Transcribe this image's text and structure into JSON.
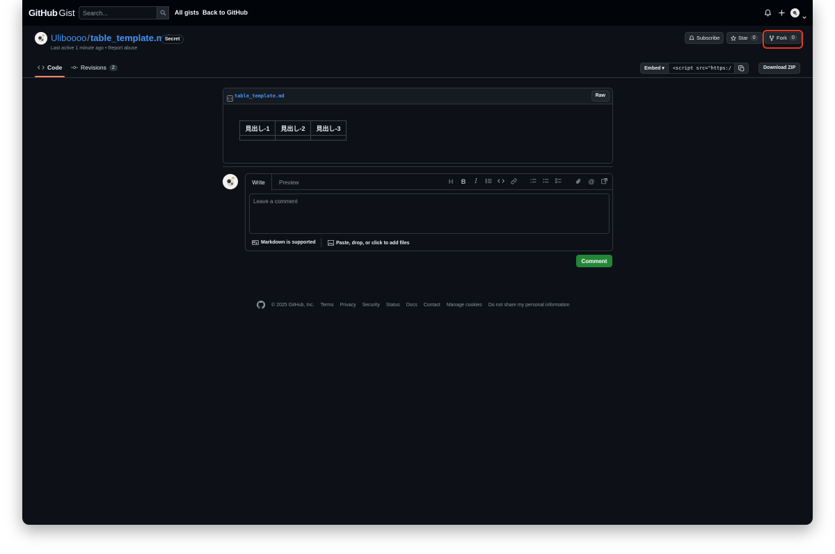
{
  "header": {
    "brand_github": "GitHub",
    "brand_gist": "Gist",
    "search_placeholder": "Search...",
    "nav": [
      "All gists",
      "Back to GitHub"
    ]
  },
  "gist": {
    "owner": "Uliboooo",
    "separator": "/",
    "filename": "table_template.md",
    "visibility_badge": "Secret",
    "last_active": "Last active 1 minute ago",
    "meta_separator": "•",
    "report_abuse": "Report abuse",
    "subscribe_label": "Subscribe",
    "star_label": "Star",
    "star_count": "0",
    "fork_label": "Fork",
    "fork_count": "0"
  },
  "tabs": {
    "code_label": "Code",
    "revisions_label": "Revisions",
    "revisions_count": "2"
  },
  "embed": {
    "select_label": "Embed",
    "url_value": "<script src=\"https:/",
    "download_label": "Download ZIP"
  },
  "file": {
    "name": "table_template.md",
    "raw_label": "Raw",
    "table_headers": [
      "見出し-1",
      "見出し-2",
      "見出し-3"
    ]
  },
  "comment": {
    "write_tab": "Write",
    "preview_tab": "Preview",
    "placeholder": "Leave a comment",
    "markdown_note": "Markdown is supported",
    "attach_note": "Paste, drop, or click to add files",
    "submit_label": "Comment"
  },
  "footer": {
    "copyright": "© 2025 GitHub, Inc.",
    "links": [
      "Terms",
      "Privacy",
      "Security",
      "Status",
      "Docs",
      "Contact",
      "Manage cookies",
      "Do not share my personal information"
    ]
  },
  "colors": {
    "accent_link": "#4493f8",
    "highlight_box": "#e53b1e",
    "comment_button": "#238636",
    "tab_underline": "#f78166"
  }
}
